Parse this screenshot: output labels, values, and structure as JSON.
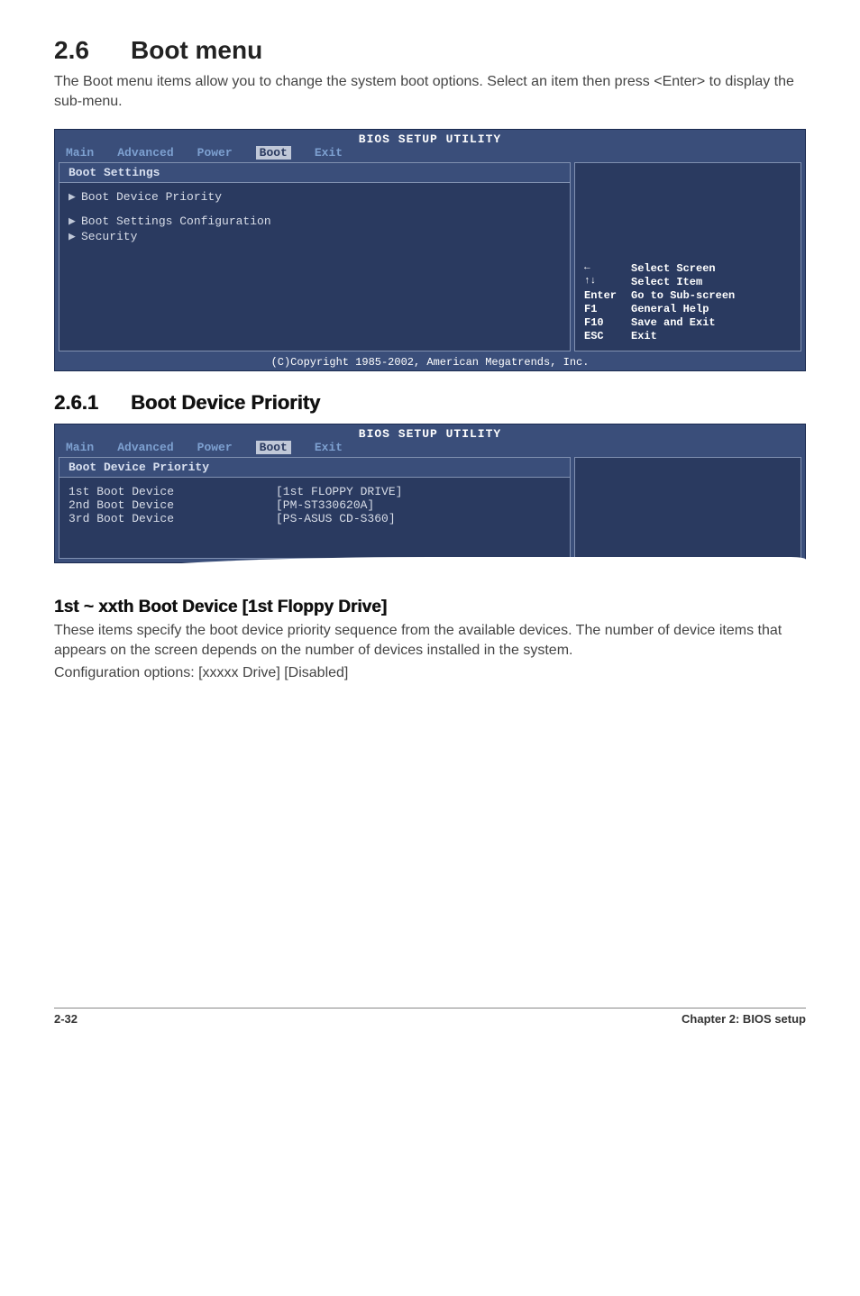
{
  "section": {
    "number": "2.6",
    "title": "Boot menu",
    "intro": "The Boot menu items allow you to change the system boot options. Select an item then press <Enter> to display the sub-menu."
  },
  "bios1": {
    "utility_title": "BIOS SETUP UTILITY",
    "tabs": [
      "Main",
      "Advanced",
      "Power",
      "Boot",
      "Exit"
    ],
    "panel_title": "Boot Settings",
    "items": [
      "Boot Device Priority",
      "Boot Settings Configuration",
      "Security"
    ],
    "help": [
      {
        "key": "←",
        "text": "Select Screen"
      },
      {
        "key": "↑↓",
        "text": "Select Item"
      },
      {
        "key": "Enter",
        "text": "Go to Sub-screen"
      },
      {
        "key": "F1",
        "text": "General Help"
      },
      {
        "key": "F10",
        "text": "Save and Exit"
      },
      {
        "key": "ESC",
        "text": "Exit"
      }
    ],
    "copyright": "(C)Copyright 1985-2002, American Megatrends, Inc."
  },
  "subsection": {
    "number": "2.6.1",
    "title": "Boot Device Priority"
  },
  "bios2": {
    "utility_title": "BIOS SETUP UTILITY",
    "tabs": [
      "Main",
      "Advanced",
      "Power",
      "Boot",
      "Exit"
    ],
    "panel_title": "Boot Device Priority",
    "rows": [
      {
        "label": "1st Boot Device",
        "value": "[1st FLOPPY DRIVE]"
      },
      {
        "label": "2nd Boot Device",
        "value": "[PM-ST330620A]"
      },
      {
        "label": "3rd Boot Device",
        "value": "[PS-ASUS CD-S360]"
      }
    ]
  },
  "field": {
    "title": "1st ~ xxth Boot Device [1st Floppy Drive]",
    "desc": "These items specify the boot device priority sequence from the available devices. The number of device items that appears on the screen depends on the number of devices installed in the system.",
    "config": "Configuration options: [xxxxx Drive] [Disabled]"
  },
  "footer": {
    "left": "2-32",
    "right": "Chapter 2: BIOS setup"
  }
}
